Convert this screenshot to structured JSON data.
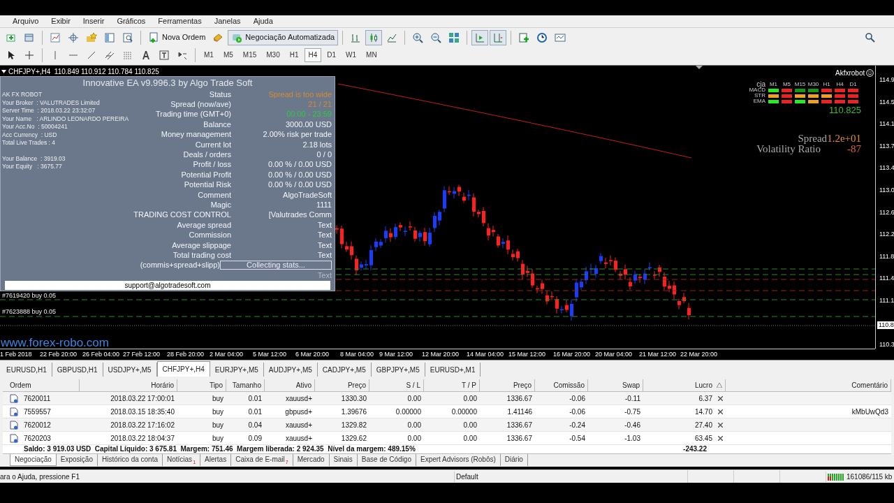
{
  "menu": [
    "Arquivo",
    "Exibir",
    "Inserir",
    "Gráficos",
    "Ferramentas",
    "Janelas",
    "Ajuda"
  ],
  "toolbar": {
    "new_order": "Nova Ordem",
    "auto_trading": {
      "label": "Negociação Automatizada",
      "on": true
    },
    "candlesticks_on": true,
    "auto_scroll_on": true,
    "chart_shift_on": true
  },
  "timeframes": [
    {
      "label": "M1",
      "selected": false
    },
    {
      "label": "M5",
      "selected": false
    },
    {
      "label": "M15",
      "selected": false
    },
    {
      "label": "M30",
      "selected": false
    },
    {
      "label": "H1",
      "selected": false
    },
    {
      "label": "H4",
      "selected": true
    },
    {
      "label": "D1",
      "selected": false
    },
    {
      "label": "W1",
      "selected": false
    },
    {
      "label": "MN",
      "selected": false
    }
  ],
  "chart": {
    "header": "CHFJPY+,H4  110.849 110.912 110.784 110.825",
    "brand": "Akfxrobot",
    "indicator_grid": {
      "corner": "cja",
      "columns": [
        "M1",
        "M5",
        "M15",
        "M30",
        "H1",
        "H4",
        "D1"
      ],
      "rows": [
        {
          "name": "MACD",
          "cells": [
            {
              "color": "#22ee22"
            },
            {
              "color": "#ee2222"
            },
            {
              "color": "#119911"
            },
            {
              "color": "#119911"
            },
            {
              "color": "#ee2222"
            },
            {
              "color": "#ee2222"
            },
            {
              "color": "#ee2222"
            }
          ]
        },
        {
          "name": "STR",
          "cells": [
            {
              "color": "#eea020"
            },
            {
              "color": "#ee2222"
            },
            {
              "color": "#eea020"
            },
            {
              "color": "#eea020"
            },
            {
              "color": "#eea020"
            },
            {
              "color": "#ee2222"
            },
            {
              "color": "#ee2222"
            }
          ]
        },
        {
          "name": "EMA",
          "cells": [
            {
              "color": "#22ee22"
            },
            {
              "color": "#ee2222"
            },
            {
              "color": "#22ee22"
            },
            {
              "color": "#eea020"
            },
            {
              "color": "#ee2222"
            },
            {
              "color": "#ee2222"
            },
            {
              "color": "#ee2222"
            }
          ]
        }
      ]
    },
    "bid": "110.825",
    "spread_label": "Spread",
    "spread_value": "1.2e+01",
    "volatility_label": "Volatility Ratio",
    "volatility_value": "-87",
    "trade_labels": [
      "#7619420 buy 0.05",
      "#7623888 buy 0.05"
    ],
    "website": "www.forex-robo.com",
    "price_axis": [
      "114.9",
      "114.5",
      "114.1",
      "113.7",
      "113.4",
      "113.0",
      "112.6",
      "112.2",
      "111.8",
      "111.4",
      "111.1",
      "110.3"
    ],
    "current_price": "110.8",
    "time_axis": [
      "1 Feb 2018",
      "22 Feb 20:00",
      "26 Feb 04:00",
      "27 Feb 12:00",
      "28 Feb 20:00",
      "2 Mar 04:00",
      "5 Mar 12:00",
      "6 Mar 20:00",
      "8 Mar 04:00",
      "9 Mar 12:00",
      "12 Mar 20:00",
      "14 Mar 04:00",
      "15 Mar 12:00",
      "16 Mar 20:00",
      "20 Mar 04:00",
      "21 Mar 12:00",
      "22 Mar 20:00"
    ]
  },
  "ea_panel": {
    "title": "Innovative EA v9.996.3 by Algo Trade Soft",
    "info": [
      "AK FX ROBOT",
      "Your Broker  : VALUTRADES Limited",
      "Server Time  : 2018.03.22 23:32:07",
      "Your Name   : ARLINDO LEONARDO PEREIRA",
      "Your Acc.No  : 50004241",
      "Acc Currency  : USD",
      "Total Live Trades : 4"
    ],
    "account": [
      "Your Balance  : 3919.03",
      "Your Equity   : 3675.77"
    ],
    "rows": [
      {
        "label": "Status",
        "value": "Spread is too wide",
        "kind": "text",
        "color": "#d98a2b"
      },
      {
        "label": "Spread (now/ave)",
        "value": "21 / 21",
        "kind": "text",
        "color": "#d98a2b"
      },
      {
        "label": "Trading time (GMT+0)",
        "value": "00:00 - 23:59",
        "kind": "text",
        "color": "#2ecc40"
      },
      {
        "label": "Balance",
        "value": "3000.00 USD",
        "kind": "text"
      },
      {
        "label": "Money management",
        "value": "2.00% risk per trade",
        "kind": "text"
      },
      {
        "label": "Current lot",
        "value": "2.18 lots",
        "kind": "text"
      },
      {
        "label": "Deals / orders",
        "value": "0 / 0",
        "kind": "text"
      },
      {
        "label": "Profit / loss",
        "value": "0.00 % / 0.00 USD",
        "kind": "text"
      },
      {
        "label": "Potential Profit",
        "value": "0.00 % / 0.00 USD",
        "kind": "text"
      },
      {
        "label": "Potential Risk",
        "value": "0.00 % / 0.00 USD",
        "kind": "text"
      },
      {
        "label": "Comment",
        "value": "AlgoTradeSoft",
        "kind": "text"
      },
      {
        "label": "Magic",
        "value": "1111",
        "kind": "text"
      },
      {
        "label": "TRADING COST CONTROL",
        "value": "[Valutrades Comm",
        "kind": "text"
      },
      {
        "label": "Average spread",
        "value": "Text",
        "kind": "text"
      },
      {
        "label": "Commission",
        "value": "Text",
        "kind": "text"
      },
      {
        "label": "Average slippage",
        "value": "Text",
        "kind": "text"
      },
      {
        "label": "Total trading cost",
        "value": "Text",
        "kind": "text"
      },
      {
        "label": "(commis+spread+slipp)",
        "value": "Collecting stats...",
        "kind": "button"
      },
      {
        "value": "Text",
        "kind": "muted"
      }
    ],
    "support": "support@algotradesoft.com"
  },
  "chart_tabs": [
    {
      "label": "EURUSD,H1",
      "selected": false
    },
    {
      "label": "GBPUSD,H1",
      "selected": false
    },
    {
      "label": "USDJPY+,M5",
      "selected": false
    },
    {
      "label": "CHFJPY+,H4",
      "selected": true
    },
    {
      "label": "EURJPY+,M5",
      "selected": false
    },
    {
      "label": "AUDJPY+,M5",
      "selected": false
    },
    {
      "label": "CADJPY+,M5",
      "selected": false
    },
    {
      "label": "GBPJPY+,M5",
      "selected": false
    },
    {
      "label": "EURUSD+,M1",
      "selected": false
    }
  ],
  "table": {
    "columns": [
      "Ordem",
      "Horário",
      "Tipo",
      "Tamanho",
      "Ativo",
      "Preço",
      "S / L",
      "T / P",
      "Preço",
      "Comissão",
      "Swap",
      "Lucro",
      "Comentário"
    ],
    "rows": [
      {
        "cells": [
          "7620011",
          "2018.03.22 17:00:01",
          "buy",
          "0.01",
          "xauusd+",
          "1330.30",
          "0.00",
          "0.00",
          "1336.67",
          "-0.06",
          "-0.11",
          "6.37"
        ]
      },
      {
        "cells": [
          "7559557",
          "2018.03.15 18:35:40",
          "buy",
          "0.01",
          "gbpusd+",
          "1.39676",
          "0.00000",
          "0.00000",
          "1.41146",
          "-0.06",
          "-0.75",
          "14.70"
        ],
        "comment": "kMbUwQd3"
      },
      {
        "cells": [
          "7620012",
          "2018.03.22 17:16:02",
          "buy",
          "0.04",
          "xauusd+",
          "1329.82",
          "0.00",
          "0.00",
          "1336.67",
          "-0.24",
          "-0.46",
          "27.40"
        ]
      },
      {
        "cells": [
          "7620203",
          "2018.03.22 18:04:37",
          "buy",
          "0.09",
          "xauusd+",
          "1329.62",
          "0.00",
          "0.00",
          "1336.67",
          "-0.54",
          "-1.03",
          "63.45"
        ]
      }
    ],
    "summary": "Saldo: 3 919.03 USD  Capital Líquido: 3 675.81  Margem: 751.46  Margem liberada: 2 924.35  Nível da margem: 489.15%",
    "summary_total": "-243.22"
  },
  "terminal_tabs": [
    {
      "label": "Negociação",
      "selected": true
    },
    {
      "label": "Exposição",
      "selected": false
    },
    {
      "label": "Histórico da conta",
      "selected": false
    },
    {
      "label": "Notícias",
      "selected": false,
      "badge": "1"
    },
    {
      "label": "Alertas",
      "selected": false
    },
    {
      "label": "Caixa de E-mail",
      "selected": false,
      "badge": "7"
    },
    {
      "label": "Mercado",
      "selected": false
    },
    {
      "label": "Sinais",
      "selected": false
    },
    {
      "label": "Base de Código",
      "selected": false
    },
    {
      "label": "Expert Advisors (Robôs)",
      "selected": false
    },
    {
      "label": "Diário",
      "selected": false
    }
  ],
  "status_bar": {
    "help": "ara o Ajuda, pressione F1",
    "profile": "Default",
    "traffic": "161086/115 kb"
  }
}
